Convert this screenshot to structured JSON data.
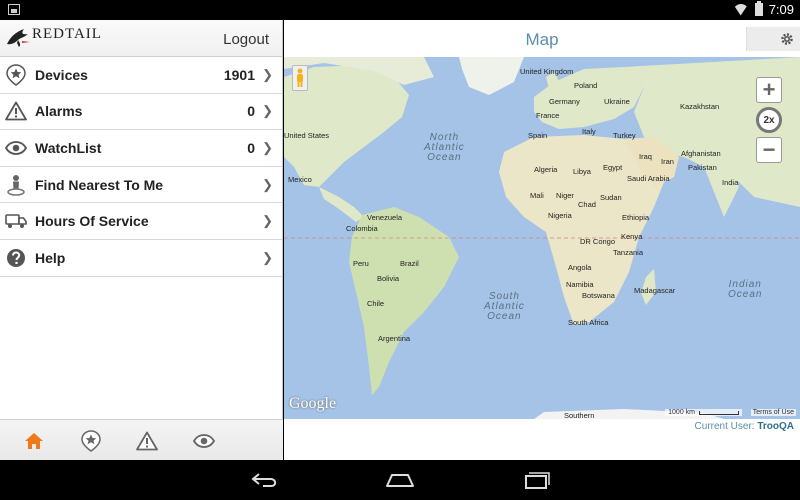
{
  "status_bar": {
    "time": "7:09"
  },
  "app": {
    "logo_text": "REDTAIL",
    "logout_label": "Logout"
  },
  "menu": [
    {
      "label": "Devices",
      "count": "1901",
      "icon": "star-pin-icon"
    },
    {
      "label": "Alarms",
      "count": "0",
      "icon": "warning-icon"
    },
    {
      "label": "WatchList",
      "count": "0",
      "icon": "eye-icon"
    },
    {
      "label": "Find Nearest To Me",
      "count": "",
      "icon": "person-pin-icon"
    },
    {
      "label": "Hours Of Service",
      "count": "",
      "icon": "truck-icon"
    },
    {
      "label": "Help",
      "count": "",
      "icon": "help-icon"
    }
  ],
  "bottom_tabs": [
    "home-icon",
    "star-pin-icon",
    "warning-icon",
    "eye-icon"
  ],
  "map": {
    "title": "Map",
    "zoom_plus": "+",
    "zoom_level": "2x",
    "zoom_minus": "−",
    "google_label": "Google",
    "scale_label": "1000 km",
    "terms_label": "Terms of Use",
    "countries": [
      "United Kingdom",
      "Poland",
      "Germany",
      "Ukraine",
      "Kazakhstan",
      "France",
      "Spain",
      "Italy",
      "Turkey",
      "United States",
      "Mexico",
      "Iraq",
      "Iran",
      "Afghanistan",
      "Pakistan",
      "India",
      "Algeria",
      "Libya",
      "Egypt",
      "Saudi Arabia",
      "Mali",
      "Niger",
      "Chad",
      "Sudan",
      "Nigeria",
      "Ethiopia",
      "Venezuela",
      "Colombia",
      "Kenya",
      "DR Congo",
      "Tanzania",
      "Peru",
      "Brazil",
      "Bolivia",
      "Angola",
      "Namibia",
      "Botswana",
      "Madagascar",
      "Chile",
      "Argentina",
      "South Africa",
      "Southern"
    ],
    "oceans": [
      "North\nAtlantic\nOcean",
      "South\nAtlantic\nOcean",
      "Indian\nOcean"
    ]
  },
  "footer": {
    "current_user_prefix": "Current User:",
    "current_user_name": "TrooQA"
  },
  "colors": {
    "accent": "#5a8fa8",
    "home_active": "#f07a1a",
    "ocean": "#a4c3e6",
    "land": "#dfe8c8"
  }
}
